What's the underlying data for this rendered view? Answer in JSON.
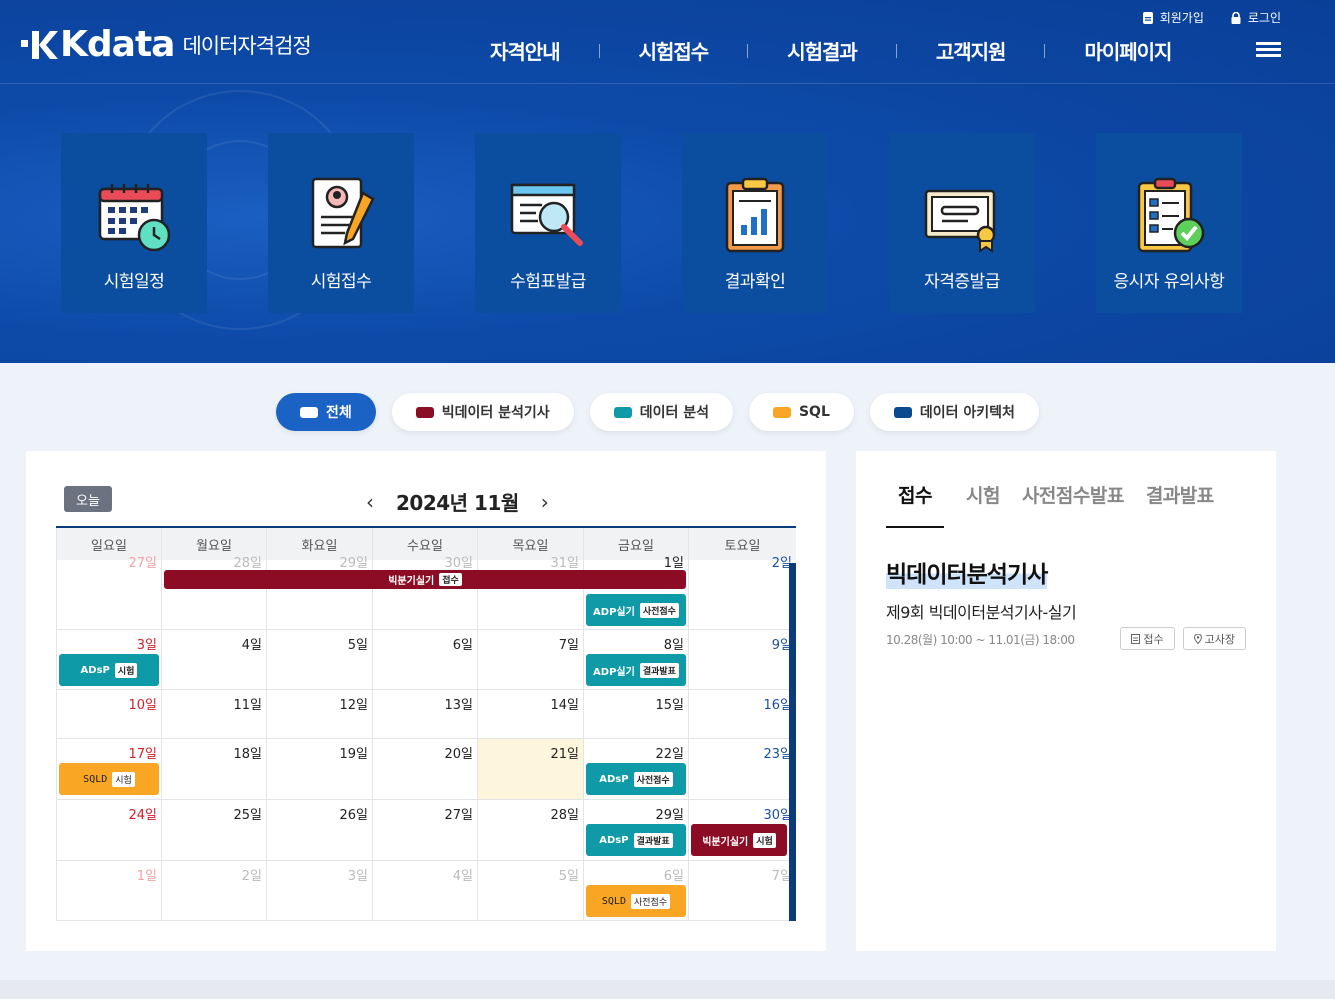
{
  "brand": {
    "logo_word": "Kdata",
    "subtitle": "데이터자격검정"
  },
  "util_nav": [
    {
      "label": "회원가입",
      "icon": "document-icon"
    },
    {
      "label": "로그인",
      "icon": "lock-icon"
    }
  ],
  "main_nav": [
    "자격안내",
    "시험접수",
    "시험결과",
    "고객지원",
    "마이페이지"
  ],
  "tiles": [
    {
      "label": "시험일정",
      "icon": "calendar-clock-icon"
    },
    {
      "label": "시험접수",
      "icon": "application-form-icon"
    },
    {
      "label": "수험표발급",
      "icon": "ticket-search-icon"
    },
    {
      "label": "결과확인",
      "icon": "clipboard-chart-icon"
    },
    {
      "label": "자격증발급",
      "icon": "certificate-icon"
    },
    {
      "label": "응시자 유의사항",
      "icon": "checklist-icon"
    }
  ],
  "filters": [
    {
      "label": "전체",
      "color": "#ffffff",
      "active": true
    },
    {
      "label": "빅데이터 분석기사",
      "color": "#8b0c24"
    },
    {
      "label": "데이터 분석",
      "color": "#0f9aa7"
    },
    {
      "label": "SQL",
      "color": "#f8a623"
    },
    {
      "label": "데이터 아키텍처",
      "color": "#0b4a8e"
    }
  ],
  "calendar": {
    "today_label": "오늘",
    "prev": "‹",
    "next": "›",
    "month_title": "2024년 11월",
    "weekdays": [
      "일요일",
      "월요일",
      "화요일",
      "수요일",
      "목요일",
      "금요일",
      "토요일"
    ],
    "weeks": [
      [
        "27일",
        "28일",
        "29일",
        "30일",
        "31일",
        "1일",
        "2일"
      ],
      [
        "3일",
        "4일",
        "5일",
        "6일",
        "7일",
        "8일",
        "9일"
      ],
      [
        "10일",
        "11일",
        "12일",
        "13일",
        "14일",
        "15일",
        "16일"
      ],
      [
        "17일",
        "18일",
        "19일",
        "20일",
        "21일",
        "22일",
        "23일"
      ],
      [
        "24일",
        "25일",
        "26일",
        "27일",
        "28일",
        "29일",
        "30일"
      ],
      [
        "1일",
        "2일",
        "3일",
        "4일",
        "5일",
        "6일",
        "7일"
      ]
    ],
    "span_event": {
      "name": "빅분기실기",
      "tag": "접수"
    },
    "events": {
      "w0_fri": {
        "name": "ADP실기",
        "tag": "사전점수"
      },
      "w1_sun": {
        "name": "ADsP",
        "tag": "시험"
      },
      "w1_fri": {
        "name": "ADP실기",
        "tag": "결과발표"
      },
      "w3_sun": {
        "name": "SQLD",
        "tag": "시험"
      },
      "w3_fri": {
        "name": "ADsP",
        "tag": "사전점수"
      },
      "w4_fri": {
        "name": "ADsP",
        "tag": "결과발표"
      },
      "w4_sat": {
        "name": "빅분기실기",
        "tag": "시험"
      },
      "w5_fri": {
        "name": "SQLD",
        "tag": "사전점수"
      }
    }
  },
  "info": {
    "tabs": [
      "접수",
      "시험",
      "사전점수발표",
      "결과발표"
    ],
    "title": "빅데이터분석기사",
    "subtitle": "제9회 빅데이터분석기사-실기",
    "date": "10.28(월) 10:00 ~ 11.01(금) 18:00",
    "btn_apply": "접수",
    "btn_venue": "고사장"
  }
}
